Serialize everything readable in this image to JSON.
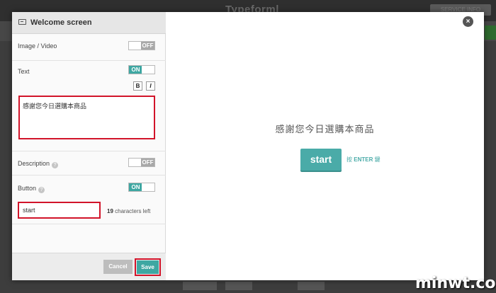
{
  "background": {
    "brand": "Typeform|",
    "pill": "SERVICE INFO"
  },
  "left_panel": {
    "title": "Welcome screen",
    "image_video": {
      "label": "Image / Video",
      "toggle": "OFF"
    },
    "text": {
      "label": "Text",
      "toggle": "ON",
      "bold": "B",
      "italic": "I",
      "value": "感謝您今日選購本商品"
    },
    "description": {
      "label": "Description",
      "help": "?",
      "toggle": "OFF"
    },
    "button": {
      "label": "Button",
      "help": "?",
      "toggle": "ON",
      "value": "start",
      "chars_count": "19",
      "chars_text": "characters left"
    },
    "cancel": "Cancel",
    "save": "Save"
  },
  "preview": {
    "close": "×",
    "title": "感謝您今日選購本商品",
    "start_button": "start",
    "hint_prefix": "按 ",
    "hint_key": "ENTER",
    "hint_suffix": " 鍵"
  },
  "watermark": "minwt.com"
}
